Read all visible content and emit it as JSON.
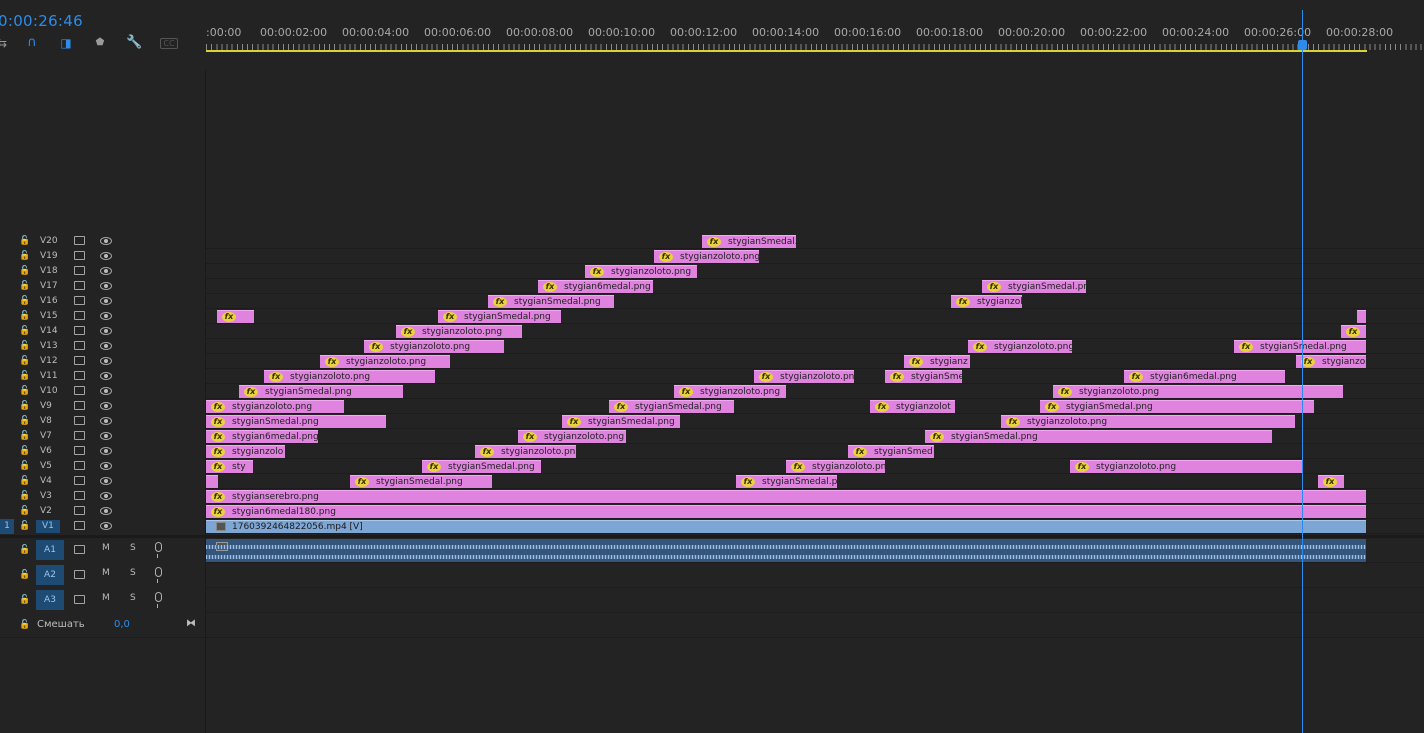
{
  "timecode": "0:00:26:46",
  "toolbar": {
    "icons": [
      "snap-icon",
      "linked-selection-icon",
      "add-marker-icon",
      "settings-wrench-icon",
      "captions-icon"
    ]
  },
  "ruler": {
    "labels": [
      ":00:00",
      "00:00:02:00",
      "00:00:04:00",
      "00:00:06:00",
      "00:00:08:00",
      "00:00:10:00",
      "00:00:12:00",
      "00:00:14:00",
      "00:00:16:00",
      "00:00:18:00",
      "00:00:20:00",
      "00:00:22:00",
      "00:00:24:00",
      "00:00:26:00",
      "00:00:28:00"
    ]
  },
  "colors": {
    "accent": "#2d8ceb",
    "clip_png": "#df83df",
    "clip_video": "#7ea6d4",
    "work_area": "#d7d236"
  },
  "video_tracks": [
    {
      "name": "V20",
      "clips": [
        {
          "label": "stygianSmedal.",
          "start": 0.4276,
          "end": 0.5086
        }
      ]
    },
    {
      "name": "V19",
      "clips": [
        {
          "label": "stygianzoloto.png",
          "start": 0.3862,
          "end": 0.4767
        }
      ]
    },
    {
      "name": "V18",
      "clips": [
        {
          "label": "stygianzoloto.png",
          "start": 0.3267,
          "end": 0.4233
        }
      ]
    },
    {
      "name": "V17",
      "clips": [
        {
          "label": "stygian6medal.png",
          "start": 0.2862,
          "end": 0.3853
        },
        {
          "label": "stygianSmedal.pn",
          "start": 0.669,
          "end": 0.7586
        }
      ]
    },
    {
      "name": "V16",
      "clips": [
        {
          "label": "stygianSmedal.png",
          "start": 0.2431,
          "end": 0.3517
        },
        {
          "label": "stygianzol",
          "start": 0.6422,
          "end": 0.7034
        }
      ]
    },
    {
      "name": "V15",
      "clips": [
        {
          "label": "",
          "start": 0.0095,
          "end": 0.0414
        },
        {
          "label": "stygianSmedal.png",
          "start": 0.2,
          "end": 0.306
        },
        {
          "label": "",
          "start": 0.9922,
          "end": 1.0
        }
      ]
    },
    {
      "name": "V14",
      "clips": [
        {
          "label": "stygianzoloto.png",
          "start": 0.1638,
          "end": 0.2724
        },
        {
          "label": "",
          "start": 0.9784,
          "end": 1.0
        }
      ]
    },
    {
      "name": "V13",
      "clips": [
        {
          "label": "stygianzoloto.png",
          "start": 0.1362,
          "end": 0.2569
        },
        {
          "label": "stygianzoloto.png",
          "start": 0.6569,
          "end": 0.7465
        },
        {
          "label": "stygianSmedal.png",
          "start": 0.8866,
          "end": 1.0
        }
      ]
    },
    {
      "name": "V12",
      "clips": [
        {
          "label": "stygianzoloto.png",
          "start": 0.0983,
          "end": 0.2103
        },
        {
          "label": "stygianz",
          "start": 0.6017,
          "end": 0.6586
        },
        {
          "label": "stygianzolo",
          "start": 0.9397,
          "end": 1.0
        }
      ]
    },
    {
      "name": "V11",
      "clips": [
        {
          "label": "stygianzoloto.png",
          "start": 0.05,
          "end": 0.1974
        },
        {
          "label": "stygianzoloto.pn",
          "start": 0.4728,
          "end": 0.5586
        },
        {
          "label": "stygianSme",
          "start": 0.5853,
          "end": 0.6517
        },
        {
          "label": "stygian6medal.png",
          "start": 0.7914,
          "end": 0.9302
        }
      ]
    },
    {
      "name": "V10",
      "clips": [
        {
          "label": "stygianSmedal.png",
          "start": 0.0284,
          "end": 0.1698
        },
        {
          "label": "stygianzoloto.png",
          "start": 0.4034,
          "end": 0.5
        },
        {
          "label": "stygianzoloto.png",
          "start": 0.7302,
          "end": 0.9802
        }
      ]
    },
    {
      "name": "V9",
      "clips": [
        {
          "label": "stygianzoloto.png",
          "start": 0.0,
          "end": 0.119
        },
        {
          "label": "stygianSmedal.png",
          "start": 0.3474,
          "end": 0.4552
        },
        {
          "label": "stygianzolot",
          "start": 0.5724,
          "end": 0.6457
        },
        {
          "label": "stygianSmedal.png",
          "start": 0.719,
          "end": 0.9556
        }
      ]
    },
    {
      "name": "V8",
      "clips": [
        {
          "label": "stygianSmedal.png",
          "start": 0.0,
          "end": 0.1552
        },
        {
          "label": "stygianSmedal.png",
          "start": 0.3069,
          "end": 0.4086
        },
        {
          "label": "stygianzoloto.png",
          "start": 0.6853,
          "end": 0.9388
        }
      ]
    },
    {
      "name": "V7",
      "clips": [
        {
          "label": "stygian6medal.png",
          "start": 0.0,
          "end": 0.0966
        },
        {
          "label": "stygianzoloto.png",
          "start": 0.269,
          "end": 0.3621
        },
        {
          "label": "stygianSmedal.png",
          "start": 0.6198,
          "end": 0.919
        }
      ]
    },
    {
      "name": "V6",
      "clips": [
        {
          "label": "stygianzolo",
          "start": 0.0,
          "end": 0.0681
        },
        {
          "label": "stygianzoloto.pn",
          "start": 0.2319,
          "end": 0.319
        },
        {
          "label": "stygianSmed",
          "start": 0.5534,
          "end": 0.6276
        }
      ]
    },
    {
      "name": "V5",
      "clips": [
        {
          "label": "sty",
          "start": 0.0,
          "end": 0.0405
        },
        {
          "label": "stygianSmedal.png",
          "start": 0.1862,
          "end": 0.2888
        },
        {
          "label": "stygianzoloto.pn",
          "start": 0.5,
          "end": 0.5853
        },
        {
          "label": "stygianzoloto.png",
          "start": 0.7448,
          "end": 0.9448
        }
      ]
    },
    {
      "name": "V4",
      "clips": [
        {
          "label": "",
          "start": 0.0,
          "end": 0.0103
        },
        {
          "label": "stygianSmedal.png",
          "start": 0.1241,
          "end": 0.2466
        },
        {
          "label": "stygianSmedal.pn",
          "start": 0.4569,
          "end": 0.544
        },
        {
          "label": "",
          "start": 0.9586,
          "end": 0.981
        }
      ]
    },
    {
      "name": "V3",
      "clips": [
        {
          "label": "stygianserebro.png",
          "start": 0.0,
          "end": 1.0
        }
      ]
    },
    {
      "name": "V2",
      "clips": [
        {
          "label": "stygian6medal180.png",
          "start": 0.0,
          "end": 1.0
        }
      ]
    },
    {
      "name": "V1",
      "source_label": "1",
      "clips": [
        {
          "label": "1760392464822056.mp4 [V]",
          "start": 0.0,
          "end": 1.0
        }
      ]
    }
  ],
  "audio_tracks": [
    {
      "name": "A1",
      "mute": "M",
      "solo": "S"
    },
    {
      "name": "A2",
      "mute": "M",
      "solo": "S"
    },
    {
      "name": "A3",
      "mute": "M",
      "solo": "S"
    }
  ],
  "mix": {
    "label": "Смешать",
    "value": "0,0"
  }
}
